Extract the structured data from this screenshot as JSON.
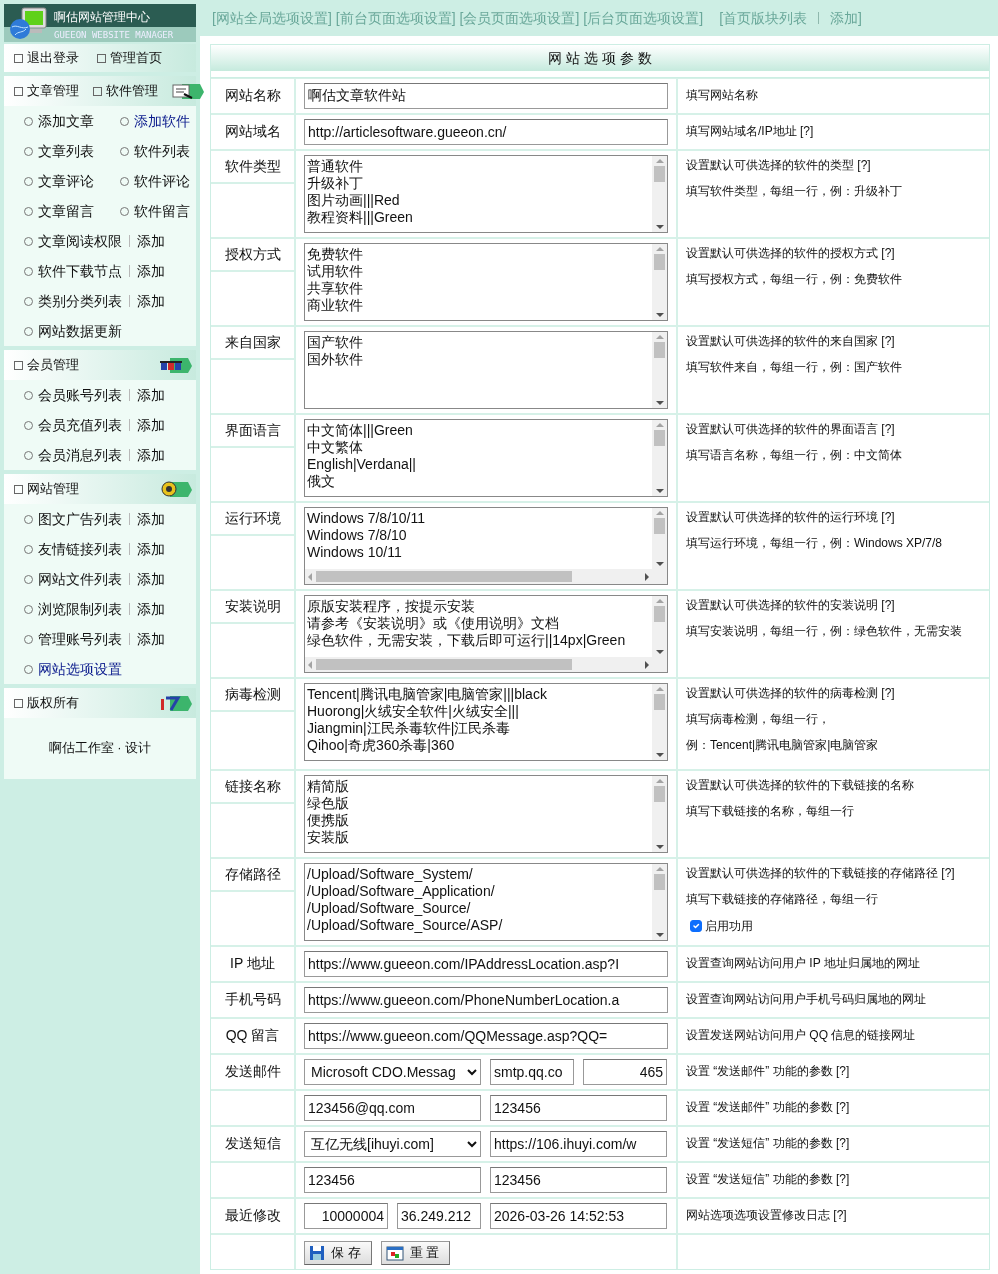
{
  "sidebar": {
    "title": "啊估网站管理中心",
    "subtitle": "GUEEON WEBSITE MANAGER",
    "top_links": [
      "退出登录",
      "管理首页"
    ],
    "sections": [
      {
        "titles": [
          "文章管理",
          "软件管理"
        ],
        "rows": [
          {
            "kind": "pair",
            "links": [
              {
                "label": "添加文章",
                "selected": false
              },
              {
                "label": "添加软件",
                "selected": true
              }
            ]
          },
          {
            "kind": "pair",
            "links": [
              {
                "label": "文章列表",
                "selected": false
              },
              {
                "label": "软件列表",
                "selected": false
              }
            ]
          },
          {
            "kind": "pair",
            "links": [
              {
                "label": "文章评论",
                "selected": false
              },
              {
                "label": "软件评论",
                "selected": false
              }
            ]
          },
          {
            "kind": "pair",
            "links": [
              {
                "label": "文章留言",
                "selected": false
              },
              {
                "label": "软件留言",
                "selected": false
              }
            ]
          },
          {
            "kind": "add",
            "links": [
              {
                "label": "文章阅读权限",
                "selected": false
              },
              {
                "label": "添加",
                "selected": false
              }
            ]
          },
          {
            "kind": "add",
            "links": [
              {
                "label": "软件下载节点",
                "selected": false
              },
              {
                "label": "添加",
                "selected": false
              }
            ]
          },
          {
            "kind": "add",
            "links": [
              {
                "label": "类别分类列表",
                "selected": false
              },
              {
                "label": "添加",
                "selected": false
              }
            ]
          },
          {
            "kind": "single",
            "links": [
              {
                "label": "网站数据更新",
                "selected": false
              }
            ]
          }
        ]
      },
      {
        "titles": [
          "会员管理"
        ],
        "rows": [
          {
            "kind": "add",
            "links": [
              {
                "label": "会员账号列表",
                "selected": false
              },
              {
                "label": "添加",
                "selected": false
              }
            ]
          },
          {
            "kind": "add",
            "links": [
              {
                "label": "会员充值列表",
                "selected": false
              },
              {
                "label": "添加",
                "selected": false
              }
            ]
          },
          {
            "kind": "add",
            "links": [
              {
                "label": "会员消息列表",
                "selected": false
              },
              {
                "label": "添加",
                "selected": false
              }
            ]
          }
        ]
      },
      {
        "titles": [
          "网站管理"
        ],
        "rows": [
          {
            "kind": "add",
            "links": [
              {
                "label": "图文广告列表",
                "selected": false
              },
              {
                "label": "添加",
                "selected": false
              }
            ]
          },
          {
            "kind": "add",
            "links": [
              {
                "label": "友情链接列表",
                "selected": false
              },
              {
                "label": "添加",
                "selected": false
              }
            ]
          },
          {
            "kind": "add",
            "links": [
              {
                "label": "网站文件列表",
                "selected": false
              },
              {
                "label": "添加",
                "selected": false
              }
            ]
          },
          {
            "kind": "add",
            "links": [
              {
                "label": "浏览限制列表",
                "selected": false
              },
              {
                "label": "添加",
                "selected": false
              }
            ]
          },
          {
            "kind": "add",
            "links": [
              {
                "label": "管理账号列表",
                "selected": false
              },
              {
                "label": "添加",
                "selected": false
              }
            ]
          },
          {
            "kind": "single",
            "links": [
              {
                "label": "网站选项设置",
                "selected": true
              }
            ]
          }
        ]
      },
      {
        "titles": [
          "版权所有"
        ],
        "note": "啊估工作室 · 设计"
      }
    ]
  },
  "top_nav": [
    {
      "label": "[网站全局选项设置]",
      "sep": false
    },
    {
      "label": "[前台页面选项设置]",
      "sep": false
    },
    {
      "label": "[会员页面选项设置]",
      "sep": false
    },
    {
      "label": "[后台页面选项设置]",
      "sep": false
    },
    {
      "label": "[首页版块列表",
      "sep": false
    },
    {
      "label": "添加]",
      "sep": true
    }
  ],
  "form": {
    "title": "网 站 选 项 参 数",
    "rows": [
      {
        "label": "网站名称",
        "fields": [
          {
            "kind": "input",
            "value": "啊估文章软件站"
          }
        ],
        "desc": [
          "填写网站名称"
        ]
      },
      {
        "label": "网站域名",
        "fields": [
          {
            "kind": "input",
            "value": "http://articlesoftware.gueeon.cn/"
          }
        ],
        "desc": [
          "填写网站域名/IP地址 [?]"
        ]
      },
      {
        "label": "软件类型",
        "fields": [
          {
            "kind": "textarea",
            "lines": [
              "普通软件",
              "升级补丁",
              "图片动画|||Red",
              "教程资料|||Green"
            ]
          }
        ],
        "desc": [
          "设置默认可供选择的软件的类型 [?]",
          "填写软件类型，每组一行，例：升级补丁"
        ]
      },
      {
        "label": "授权方式",
        "fields": [
          {
            "kind": "textarea",
            "lines": [
              "免费软件",
              "试用软件",
              "共享软件",
              "商业软件"
            ]
          }
        ],
        "desc": [
          "设置默认可供选择的软件的授权方式 [?]",
          "填写授权方式，每组一行，例：免费软件"
        ]
      },
      {
        "label": "来自国家",
        "fields": [
          {
            "kind": "textarea",
            "lines": [
              "国产软件",
              "国外软件"
            ]
          }
        ],
        "desc": [
          "设置默认可供选择的软件的来自国家 [?]",
          "填写软件来自，每组一行，例：国产软件"
        ]
      },
      {
        "label": "界面语言",
        "fields": [
          {
            "kind": "textarea",
            "lines": [
              "中文简体|||Green",
              "中文繁体",
              "English|Verdana||",
              "俄文"
            ]
          }
        ],
        "desc": [
          "设置默认可供选择的软件的界面语言 [?]",
          "填写语言名称，每组一行，例：中文简体"
        ]
      },
      {
        "label": "运行环境",
        "fields": [
          {
            "kind": "textarea",
            "hscroll": true,
            "lines": [
              "Windows 7/8/10/11",
              "Windows 7/8/10",
              "Windows 10/11"
            ]
          }
        ],
        "desc": [
          "设置默认可供选择的软件的运行环境 [?]",
          "填写运行环境，每组一行，例：Windows XP/7/8"
        ]
      },
      {
        "label": "安装说明",
        "fields": [
          {
            "kind": "textarea",
            "hscroll": true,
            "lines": [
              "原版安装程序，按提示安装",
              "请参考《安装说明》或《使用说明》文档",
              "绿色软件，无需安装，下载后即可运行||14px|Green"
            ]
          }
        ],
        "desc": [
          "设置默认可供选择的软件的安装说明 [?]",
          "填写安装说明，每组一行，例：绿色软件，无需安装"
        ]
      },
      {
        "label": "病毒检测",
        "fields": [
          {
            "kind": "textarea",
            "lines": [
              "Tencent|腾讯电脑管家|电脑管家|||black",
              "Huorong|火绒安全软件|火绒安全|||",
              "Jiangmin|江民杀毒软件|江民杀毒",
              "Qihoo|奇虎360杀毒|360"
            ]
          }
        ],
        "desc": [
          "设置默认可供选择的软件的病毒检测 [?]",
          "填写病毒检测，每组一行，",
          "例：Tencent|腾讯电脑管家|电脑管家"
        ]
      },
      {
        "label": "链接名称",
        "fields": [
          {
            "kind": "textarea",
            "lines": [
              "精简版",
              "绿色版",
              "便携版",
              "安装版"
            ]
          }
        ],
        "desc": [
          "设置默认可供选择的软件的下载链接的名称",
          "填写下载链接的名称，每组一行"
        ]
      },
      {
        "label": "存储路径",
        "fields": [
          {
            "kind": "textarea",
            "lines": [
              "/Upload/Software_System/",
              "/Upload/Software_Application/",
              "/Upload/Software_Source/",
              "/Upload/Software_Source/ASP/"
            ]
          }
        ],
        "desc": [
          "设置默认可供选择的软件的下载链接的存储路径 [?]",
          "填写下载链接的存储路径，每组一行"
        ],
        "option": {
          "label": "启用功用",
          "checked": true
        }
      },
      {
        "label": "IP 地址",
        "fields": [
          {
            "kind": "input",
            "value": "https://www.gueeon.com/IPAddressLocation.asp?I"
          }
        ],
        "desc": [
          "设置查询网站访问用户 IP 地址归属地的网址"
        ]
      },
      {
        "label": "手机号码",
        "fields": [
          {
            "kind": "input",
            "value": "https://www.gueeon.com/PhoneNumberLocation.a"
          }
        ],
        "desc": [
          "设置查询网站访问用户手机号码归属地的网址"
        ]
      },
      {
        "label": "QQ 留言",
        "fields": [
          {
            "kind": "input",
            "value": "https://www.gueeon.com/QQMessage.asp?QQ="
          }
        ],
        "desc": [
          "设置发送网站访问用户 QQ 信息的链接网址"
        ]
      },
      {
        "label": "发送邮件",
        "fields": [
          {
            "kind": "select",
            "value": "Microsoft CDO.Messag"
          },
          {
            "kind": "input",
            "value": "smtp.qq.co"
          },
          {
            "kind": "number",
            "value": "465"
          }
        ],
        "desc": [
          "设置 “发送邮件” 功能的参数 [?]"
        ]
      },
      {
        "fields": [
          {
            "kind": "input",
            "value": "123456@qq.com"
          },
          {
            "kind": "input",
            "value": "123456"
          }
        ],
        "desc": [
          "设置 “发送邮件” 功能的参数 [?]"
        ]
      },
      {
        "label": "发送短信",
        "fields": [
          {
            "kind": "select",
            "value": "互亿无线[ihuyi.com]"
          },
          {
            "kind": "input",
            "value": "https://106.ihuyi.com/w"
          }
        ],
        "desc": [
          "设置 “发送短信” 功能的参数 [?]"
        ]
      },
      {
        "fields": [
          {
            "kind": "input",
            "value": "123456"
          },
          {
            "kind": "input",
            "value": "123456"
          }
        ],
        "desc": [
          "设置 “发送短信” 功能的参数 [?]"
        ]
      },
      {
        "label": "最近修改",
        "fields": [
          {
            "kind": "number",
            "value": "10000004"
          },
          {
            "kind": "input",
            "value": "36.249.212"
          },
          {
            "kind": "input",
            "value": "2026-03-26 14:52:53"
          }
        ],
        "desc": [
          "网站选项选项设置修改日志 [?]"
        ]
      },
      {
        "fields": [
          {
            "kind": "button",
            "value": "保 存"
          },
          {
            "kind": "button",
            "value": "重 置"
          }
        ]
      }
    ]
  }
}
